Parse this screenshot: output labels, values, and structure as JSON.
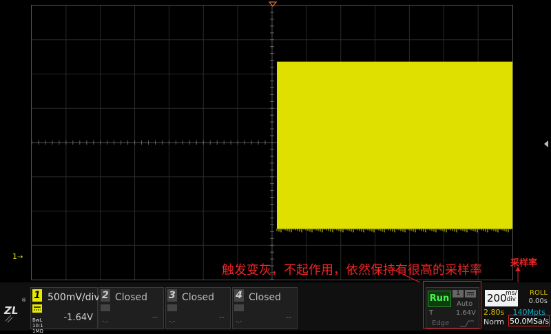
{
  "channel_marker": "1",
  "channels": [
    {
      "num": "1",
      "scale": "500mV/div",
      "offset": "-1.64V",
      "coupling": "BwL",
      "probe": "10:1",
      "impedance": "1MΩ"
    },
    {
      "num": "2",
      "status": "Closed",
      "dash_left": "-.-",
      "dash_right": "--"
    },
    {
      "num": "3",
      "status": "Closed",
      "dash_left": "-.-",
      "dash_right": "--"
    },
    {
      "num": "4",
      "status": "Closed",
      "dash_left": "-.-",
      "dash_right": "--"
    }
  ],
  "trigger": {
    "state": "Run",
    "source": "1",
    "mode": "Auto",
    "t_label": "T",
    "level": "1.64V",
    "type": "Edge"
  },
  "timebase": {
    "value": "200",
    "unit_top": "ms/",
    "unit_bottom": "div",
    "roll_label": "ROLL",
    "delay": "0.00s",
    "position": "2.80s",
    "memory": "140Mpts",
    "acq_mode": "Norm",
    "sample_rate": "50.0MSa/s"
  },
  "annotations": {
    "main": "触发变灰，不起作用，依然保持有很高的采样率",
    "sample_rate_label": "采样率"
  },
  "colors": {
    "ch1": "#e8e800",
    "waveform": "#e0e000",
    "run": "#4ef04e",
    "annotation": "#f02525"
  }
}
